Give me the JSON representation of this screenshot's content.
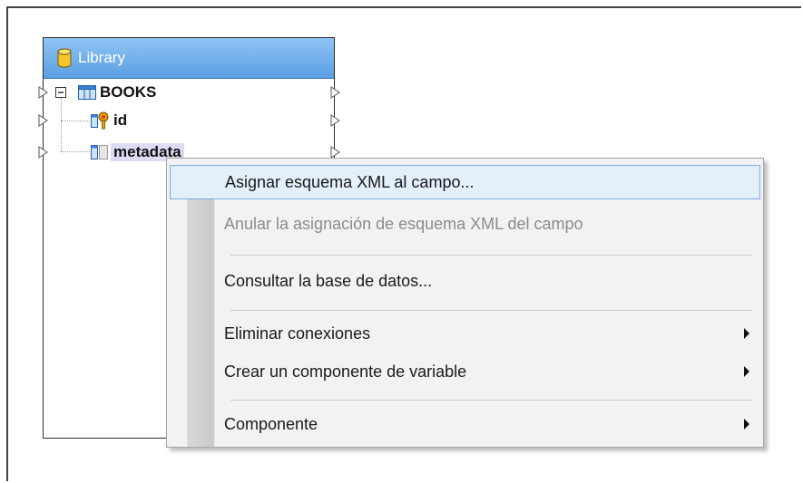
{
  "component": {
    "title": "Library",
    "table_name": "BOOKS",
    "fields": [
      {
        "name": "id"
      },
      {
        "name": "metadata"
      }
    ]
  },
  "context_menu": {
    "items": [
      {
        "label": "Asignar esquema XML al campo...",
        "enabled": true,
        "highlighted": true,
        "submenu": false
      },
      {
        "label": "Anular la asignación de esquema XML del campo",
        "enabled": false,
        "highlighted": false,
        "submenu": false
      },
      {
        "label": "Consultar la base de datos...",
        "enabled": true,
        "highlighted": false,
        "submenu": false
      },
      {
        "label": "Eliminar conexiones",
        "enabled": true,
        "highlighted": false,
        "submenu": true
      },
      {
        "label": "Crear un componente de variable",
        "enabled": true,
        "highlighted": false,
        "submenu": true
      },
      {
        "label": "Componente",
        "enabled": true,
        "highlighted": false,
        "submenu": true
      }
    ]
  },
  "colors": {
    "header_gradient_top": "#8fc4f3",
    "header_gradient_bottom": "#5a9fe2",
    "menu_highlight": "#e3effb",
    "menu_highlight_border": "#7aaee3",
    "selected_field": "#dcdcf4"
  }
}
